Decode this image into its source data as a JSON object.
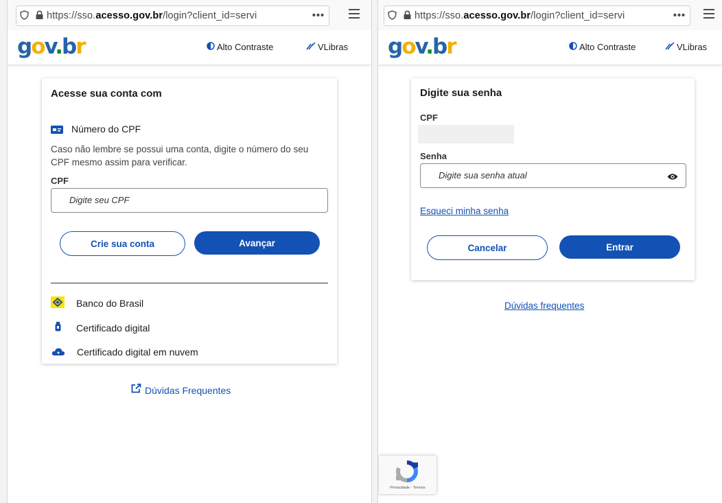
{
  "browser": {
    "url_prefix": "https://sso.",
    "url_domain": "acesso.gov.br",
    "url_suffix": "/login?client_id=servi",
    "more_label": "•••"
  },
  "header": {
    "logo": {
      "g": "g",
      "o": "o",
      "v": "v",
      "dot": ".",
      "b": "b",
      "r": "r"
    },
    "contrast_label": "Alto Contraste",
    "vlibras_label": "VLibras"
  },
  "login": {
    "title": "Acesse sua conta com",
    "cpf_option_label": "Número do CPF",
    "help_text": "Caso não lembre se possui uma conta, digite o número do seu CPF mesmo assim para verificar.",
    "cpf_label": "CPF",
    "cpf_placeholder": "Digite seu CPF",
    "create_account_label": "Crie sua conta",
    "next_label": "Avançar",
    "other_options": [
      {
        "label": "Banco do Brasil",
        "icon": "banco-do-brasil-icon"
      },
      {
        "label": "Certificado digital",
        "icon": "usb-token-icon"
      },
      {
        "label": "Certificado digital em nuvem",
        "icon": "cloud-icon"
      }
    ],
    "faq_label": "Dúvidas Frequentes"
  },
  "password": {
    "title": "Digite sua senha",
    "cpf_label": "CPF",
    "senha_label": "Senha",
    "senha_placeholder": "Digite sua senha atual",
    "forgot_label": "Esqueci minha senha",
    "cancel_label": "Cancelar",
    "enter_label": "Entrar",
    "faq_label": "Dúvidas frequentes",
    "recaptcha_text": "Privacidade - Termos"
  },
  "colors": {
    "primary": "#1351b4",
    "logo_blue": "#2664a8",
    "logo_yellow": "#f2b100",
    "logo_green": "#168821"
  }
}
